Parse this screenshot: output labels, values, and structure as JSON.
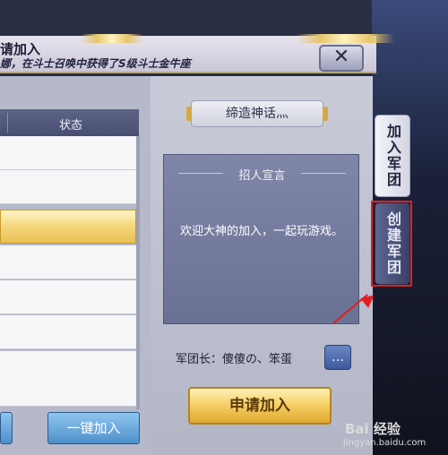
{
  "header": {
    "title": "请加入",
    "ticker": "娜，在斗士召唤中获得了S级斗士金牛座"
  },
  "close_button": {
    "label": "✕"
  },
  "member_list": {
    "column_status": "状态",
    "rows": [
      {
        "selected": false
      },
      {
        "selected": false
      },
      {
        "selected": true
      },
      {
        "selected": false
      },
      {
        "selected": false
      },
      {
        "selected": false
      },
      {
        "selected": false
      }
    ]
  },
  "bottom_buttons": {
    "left_label": "",
    "one_click_join": "一键加入"
  },
  "guild": {
    "name": "缔造神话灬",
    "manifesto_title": "招人宣言",
    "manifesto_text": "欢迎大神的加入，一起玩游戏。",
    "leader_text": "军团长：傻傻の、笨蛋",
    "apply_button": "申请加入"
  },
  "side_tabs": {
    "join_legion": "加入军团",
    "create_legion": "创建军团"
  },
  "watermark": {
    "brand": "Bai 经验",
    "url": "jingyan.baidu.com"
  },
  "colors": {
    "accent_gold": "#f4cd62",
    "highlight_red": "#e21f1f",
    "tab_active": "#f4f4f8",
    "tab_inactive": "#3b4168"
  }
}
